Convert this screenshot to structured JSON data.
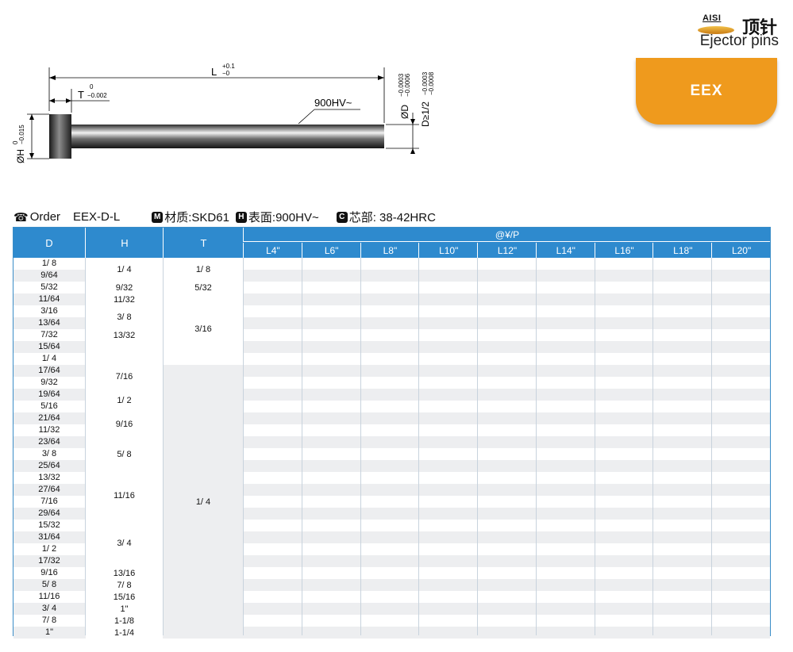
{
  "brand": {
    "aisl": "AISI",
    "title_cn": "顶针",
    "subtitle": "Ejector pins",
    "code": "EEX"
  },
  "drawing": {
    "L_label": "L",
    "L_tol_upper": "+0.1",
    "L_tol_lower": "−0",
    "T_label": "T",
    "T_tol_upper": "0",
    "T_tol_lower": "−0.002",
    "hardness": "900HV~",
    "H_label": "ØH",
    "H_tol_upper": "0",
    "H_tol_lower": "−0.015",
    "D_label": "ØD",
    "D_tol_upper": "−0.0003",
    "D_tol_lower": "−0.0006",
    "D2_label": "D≥1/2",
    "D2_tol_upper": "−0.0003",
    "D2_tol_lower": "−0.0008"
  },
  "order": {
    "phone_icon": "☎",
    "label": "Order",
    "code": "EEX-D-L",
    "material_badge": "M",
    "material": "材质:SKD61",
    "surface_badge": "H",
    "surface": "表面:900HV~",
    "core_badge": "C",
    "core": "芯部: 38-42HRC"
  },
  "table": {
    "headers": {
      "D": "D",
      "H": "H",
      "T": "T",
      "price": "@¥/P"
    },
    "lengths": [
      "L4\"",
      "L6\"",
      "L8\"",
      "L10\"",
      "L12\"",
      "L14\"",
      "L16\"",
      "L18\"",
      "L20\""
    ],
    "D": [
      "1/ 8",
      "9/64",
      "5/32",
      "11/64",
      "3/16",
      "13/64",
      "7/32",
      "15/64",
      "1/ 4",
      "17/64",
      "9/32",
      "19/64",
      "5/16",
      "21/64",
      "11/32",
      "23/64",
      "3/ 8",
      "25/64",
      "13/32",
      "27/64",
      "7/16",
      "29/64",
      "15/32",
      "31/64",
      "1/ 2",
      "17/32",
      "9/16",
      "5/ 8",
      "11/16",
      "3/ 4",
      "7/ 8",
      "1\""
    ],
    "H_groups": [
      {
        "start": 0,
        "span": 2,
        "value": "1/ 4"
      },
      {
        "start": 2,
        "span": 1,
        "value": "9/32"
      },
      {
        "start": 3,
        "span": 1,
        "value": "11/32"
      },
      {
        "start": 4,
        "span": 2,
        "value": "3/ 8"
      },
      {
        "start": 6,
        "span": 1,
        "value": "13/32"
      },
      {
        "start": 7,
        "span": 2,
        "value": ""
      },
      {
        "start": 9,
        "span": 2,
        "value": "7/16"
      },
      {
        "start": 11,
        "span": 2,
        "value": "1/ 2"
      },
      {
        "start": 13,
        "span": 2,
        "value": "9/16"
      },
      {
        "start": 15,
        "span": 3,
        "value": "5/ 8"
      },
      {
        "start": 18,
        "span": 4,
        "value": "11/16"
      },
      {
        "start": 22,
        "span": 4,
        "value": "3/ 4"
      },
      {
        "start": 26,
        "span": 1,
        "value": "13/16"
      },
      {
        "start": 27,
        "span": 1,
        "value": "7/ 8"
      },
      {
        "start": 28,
        "span": 1,
        "value": "15/16"
      },
      {
        "start": 29,
        "span": 1,
        "value": "1\""
      },
      {
        "start": 30,
        "span": 1,
        "value": "1-1/8"
      },
      {
        "start": 31,
        "span": 1,
        "value": "1-1/4"
      }
    ],
    "T_groups": [
      {
        "start": 0,
        "span": 2,
        "value": "1/ 8"
      },
      {
        "start": 2,
        "span": 1,
        "value": "5/32"
      },
      {
        "start": 3,
        "span": 6,
        "value": "3/16"
      },
      {
        "start": 9,
        "span": 23,
        "value": "1/ 4"
      }
    ]
  }
}
